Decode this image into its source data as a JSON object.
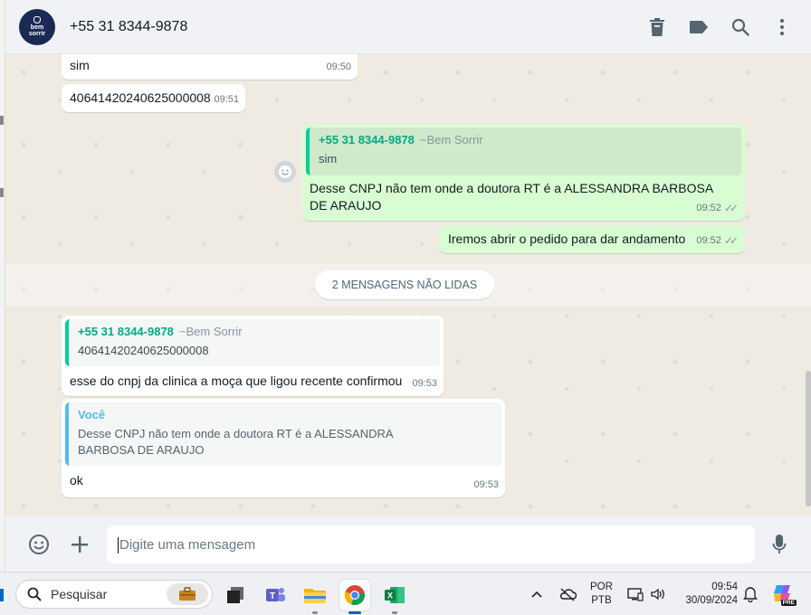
{
  "header": {
    "contact": "+55 31 8344-9878",
    "avatar_text_line1": "bem",
    "avatar_text_line2": "sorrir"
  },
  "messages": {
    "m1": {
      "text": "sim",
      "time": "09:50"
    },
    "m2": {
      "text": "40641420240625000008",
      "time": "09:51"
    },
    "m3": {
      "quote_author": "+55 31 8344-9878",
      "quote_alias": "~Bem Sorrir",
      "quote_text": "sim",
      "text": "Desse CNPJ não tem onde a doutora RT é a ALESSANDRA BARBOSA DE ARAUJO",
      "time": "09:52"
    },
    "m4": {
      "text": "Iremos abrir o pedido para dar andamento",
      "time": "09:52"
    },
    "unread": "2 MENSAGENS NÃO LIDAS",
    "m5": {
      "quote_author": "+55 31 8344-9878",
      "quote_alias": "~Bem Sorrir",
      "quote_text": "40641420240625000008",
      "text": "esse do cnpj da clinica a moça que ligou recente confirmou",
      "time": "09:53"
    },
    "m6": {
      "quote_author": "Você",
      "quote_text": "Desse CNPJ não tem onde a doutora RT é a ALESSANDRA BARBOSA DE ARAUJO",
      "text": "ok",
      "time": "09:53"
    }
  },
  "composer": {
    "placeholder": "Digite uma mensagem"
  },
  "taskbar": {
    "search_label": "Pesquisar",
    "lang_line1": "POR",
    "lang_line2": "PTB",
    "clock_time": "09:54",
    "clock_date": "30/09/2024",
    "copilot_badge": "PRE"
  },
  "colors": {
    "outgoing_bubble": "#d9fdd3",
    "chat_background": "#efeae2",
    "quote_accent": "#06cf9c",
    "you_accent": "#53bdeb"
  }
}
